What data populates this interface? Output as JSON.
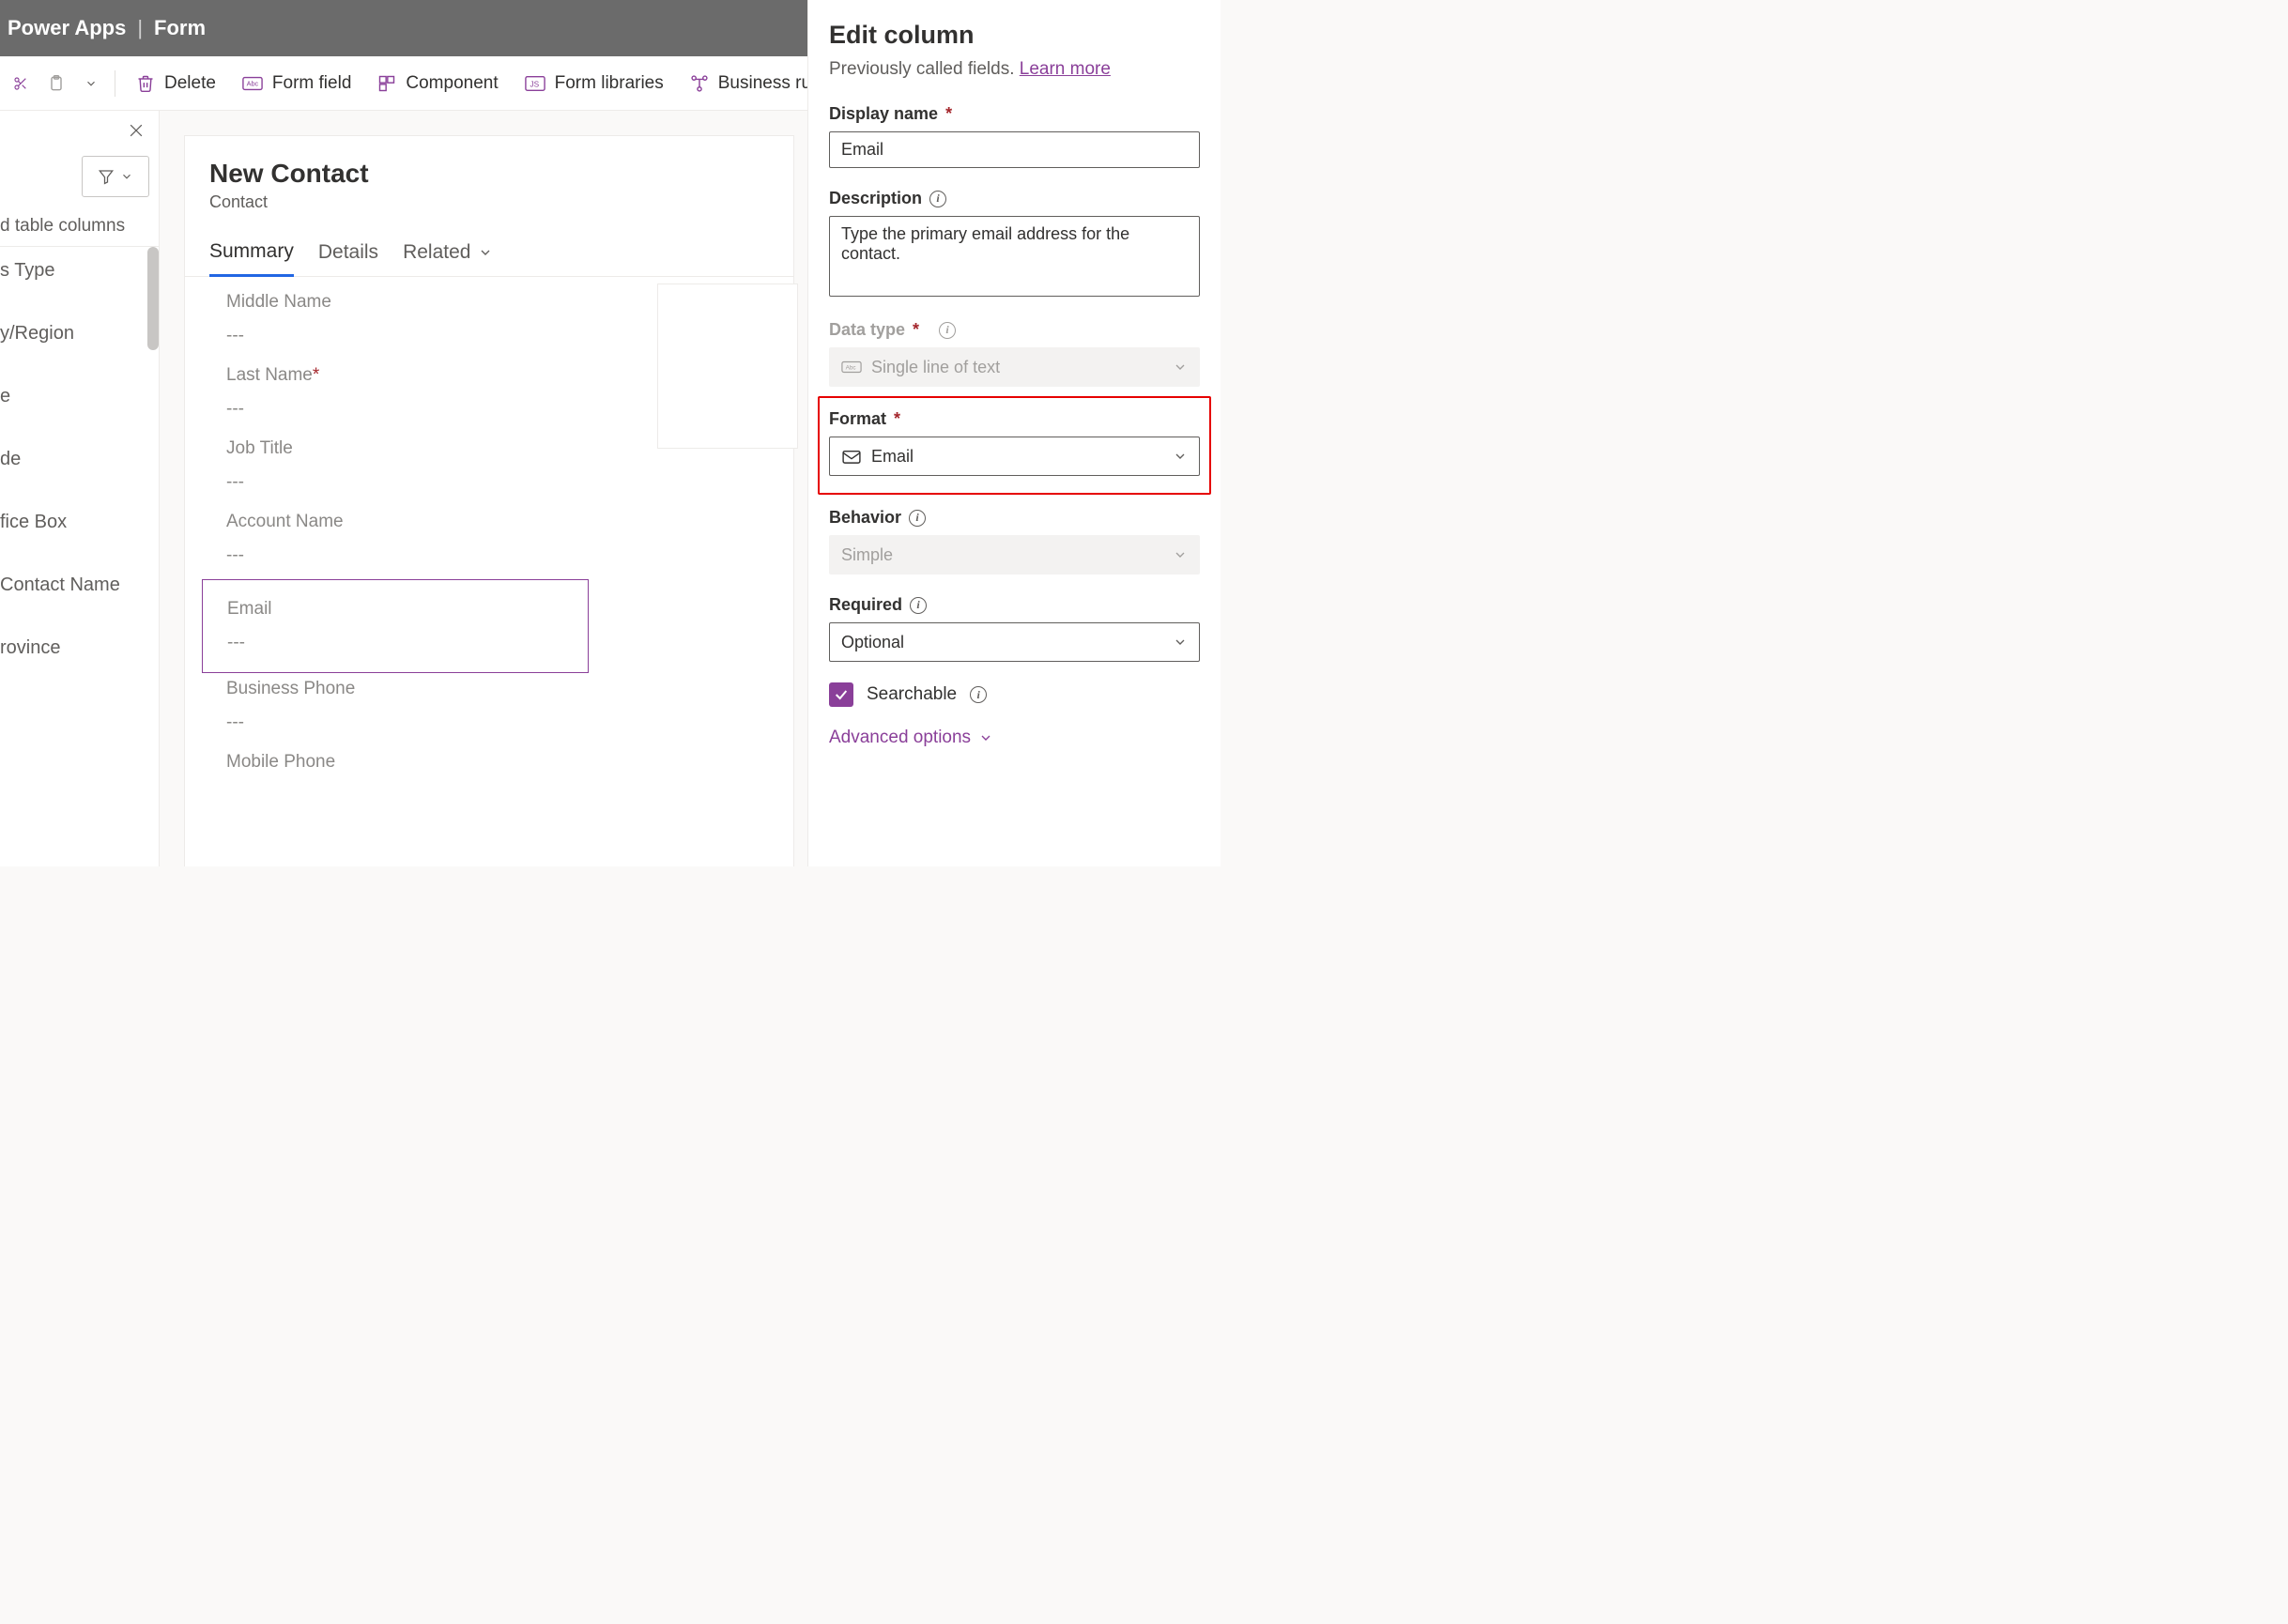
{
  "header": {
    "brand": "Power Apps",
    "section": "Form"
  },
  "toolbar": {
    "delete": "Delete",
    "form_field": "Form field",
    "component": "Component",
    "form_libraries": "Form libraries",
    "business_rules": "Business rules"
  },
  "left": {
    "heading": "d table columns",
    "items": [
      "s Type",
      "y/Region",
      "e",
      "de",
      "fice Box",
      "Contact Name",
      "rovince"
    ]
  },
  "form": {
    "title": "New Contact",
    "entity": "Contact",
    "tabs": {
      "summary": "Summary",
      "details": "Details",
      "related": "Related"
    },
    "fields": {
      "middle_name": {
        "label": "Middle Name",
        "value": "---"
      },
      "last_name": {
        "label": "Last Name",
        "value": "---"
      },
      "job_title": {
        "label": "Job Title",
        "value": "---"
      },
      "account": {
        "label": "Account Name",
        "value": "---"
      },
      "email": {
        "label": "Email",
        "value": "---"
      },
      "bus_phone": {
        "label": "Business Phone",
        "value": "---"
      },
      "mob_phone": {
        "label": "Mobile Phone",
        "value": ""
      }
    }
  },
  "panel": {
    "title": "Edit column",
    "subtitle_prefix": "Previously called fields. ",
    "learn_more": "Learn more",
    "display_name_label": "Display name",
    "display_name_value": "Email",
    "description_label": "Description",
    "description_value": "Type the primary email address for the contact.",
    "data_type_label": "Data type",
    "data_type_value": "Single line of text",
    "format_label": "Format",
    "format_value": "Email",
    "behavior_label": "Behavior",
    "behavior_value": "Simple",
    "required_label": "Required",
    "required_value": "Optional",
    "searchable_label": "Searchable",
    "advanced_label": "Advanced options"
  }
}
